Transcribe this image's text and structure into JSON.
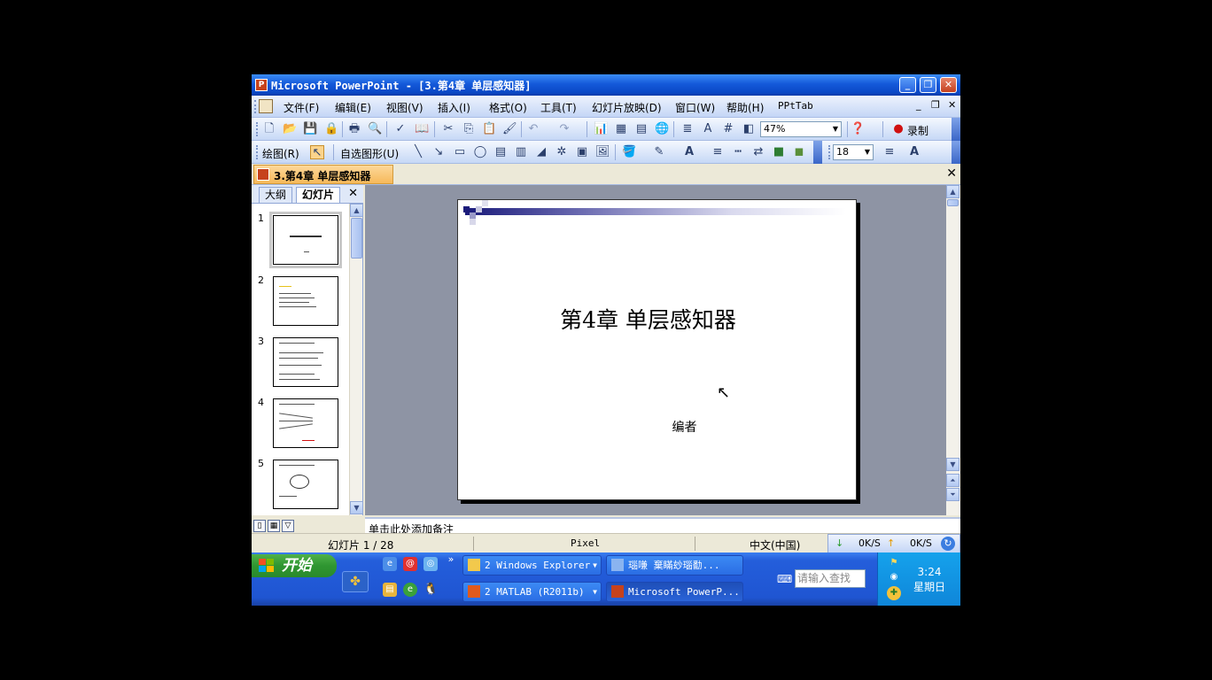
{
  "window": {
    "title": "Microsoft PowerPoint - [3.第4章  单层感知器]"
  },
  "menu": {
    "items": [
      "文件(F)",
      "编辑(E)",
      "视图(V)",
      "插入(I)",
      "格式(O)",
      "工具(T)",
      "幻灯片放映(D)",
      "窗口(W)",
      "帮助(H)",
      "PPtTab"
    ]
  },
  "toolbar": {
    "zoom": "47%",
    "record_label": "录制",
    "draw_label": "绘图(R)",
    "autoshapes_label": "自选图形(U)",
    "font_size": "18"
  },
  "doc_tab": {
    "label": "3.第4章  单层感知器"
  },
  "panel": {
    "tab_outline": "大纲",
    "tab_slides": "幻灯片",
    "thumbnails": [
      "1",
      "2",
      "3",
      "4",
      "5"
    ]
  },
  "slide": {
    "title": "第4章  单层感知器",
    "subtitle": "编者"
  },
  "notes": {
    "placeholder": "单击此处添加备注"
  },
  "status": {
    "slide_counter": "幻灯片 1 / 28",
    "design": "Pixel",
    "language": "中文(中国)",
    "down_speed": "0K/S",
    "up_speed": "0K/S"
  },
  "taskbar": {
    "start_label": "开始",
    "tasks_row1": [
      "2 Windows Explorer",
      "瑙嗛  棄瞞玅瑙勫..."
    ],
    "tasks_row2": [
      "2 MATLAB (R2011b)",
      "Microsoft PowerP..."
    ],
    "search_placeholder": "请输入查找",
    "clock_time": "3:24",
    "clock_day": "星期日"
  },
  "colors": {
    "titlebar": "#0a48c6",
    "workarea": "#8e94a4",
    "taskbar": "#245edb",
    "start": "#2f9631"
  }
}
